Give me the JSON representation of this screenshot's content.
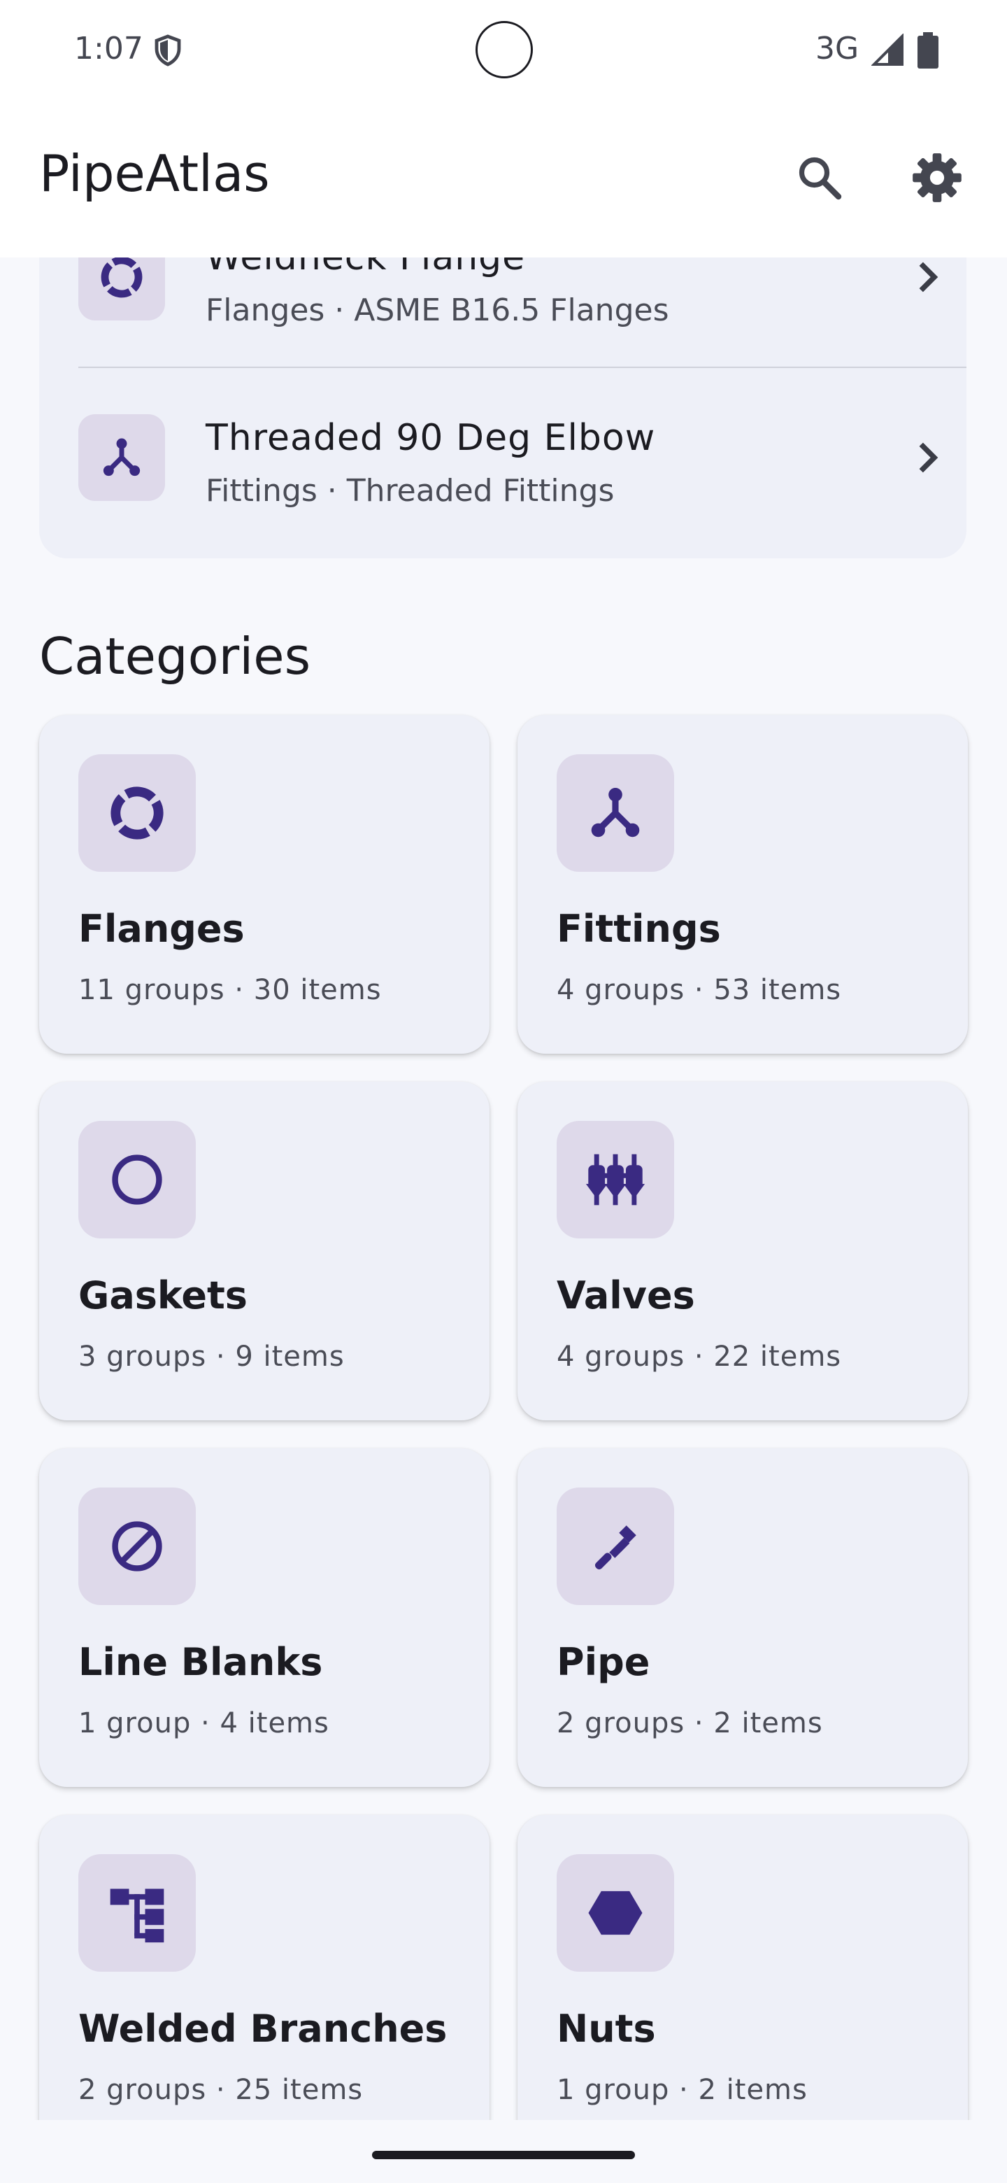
{
  "status_bar": {
    "time": "1:07",
    "network": "3G",
    "icons": [
      "shield-icon",
      "signal-icon",
      "battery-icon"
    ]
  },
  "app_bar": {
    "title": "PipeAtlas",
    "actions": [
      "search-icon",
      "gear-icon"
    ]
  },
  "recent": [
    {
      "title": "Weldneck Flange",
      "subtitle": "Flanges · ASME B16.5 Flanges",
      "icon": "flange-ring-icon"
    },
    {
      "title": "Threaded 90 Deg Elbow",
      "subtitle": "Fittings · Threaded Fittings",
      "icon": "fitting-branch-icon"
    }
  ],
  "categories_title": "Categories",
  "categories": [
    {
      "name": "Flanges",
      "meta": "11 groups · 30 items",
      "icon": "flange-ring-icon"
    },
    {
      "name": "Fittings",
      "meta": "4 groups · 53 items",
      "icon": "fitting-branch-icon"
    },
    {
      "name": "Gaskets",
      "meta": "3 groups · 9 items",
      "icon": "gasket-circle-icon"
    },
    {
      "name": "Valves",
      "meta": "4 groups · 22 items",
      "icon": "valve-bank-icon"
    },
    {
      "name": "Line Blanks",
      "meta": "1 group · 4 items",
      "icon": "blank-slash-icon"
    },
    {
      "name": "Pipe",
      "meta": "2 groups · 2 items",
      "icon": "pipe-wrench-icon"
    },
    {
      "name": "Welded Branches",
      "meta": "2 groups · 25 items",
      "icon": "branch-tree-icon"
    },
    {
      "name": "Nuts",
      "meta": "1 group · 2 items",
      "icon": "hexagon-nut-icon"
    }
  ],
  "colors": {
    "primary": "#3a2a82",
    "icon_container": "#ded9ea",
    "card": "#eef0f8",
    "background": "#f7f8fc"
  }
}
